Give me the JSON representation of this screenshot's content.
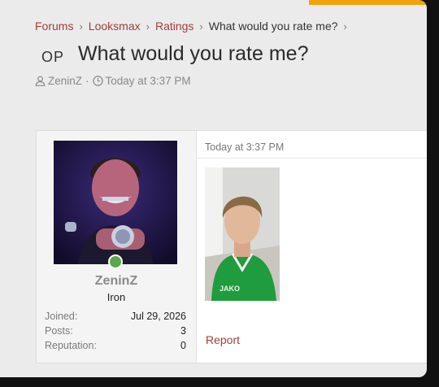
{
  "breadcrumbs": [
    {
      "label": "Forums"
    },
    {
      "label": "Looksmax"
    },
    {
      "label": "Ratings"
    },
    {
      "label": "What would you rate me?"
    }
  ],
  "thread": {
    "prefix": "OP",
    "title": "What would you rate me?",
    "author": "ZeninZ",
    "meta_sep": "·",
    "time": "Today at 3:37 PM"
  },
  "post": {
    "username": "ZeninZ",
    "rank": "Iron",
    "stats": [
      {
        "label": "Joined:",
        "value": "Jul 29, 2026"
      },
      {
        "label": "Posts:",
        "value": "3"
      },
      {
        "label": "Reputation:",
        "value": "0"
      }
    ],
    "timestamp": "Today at 3:37 PM",
    "report_label": "Report",
    "jersey_text": "JAKO"
  },
  "colors": {
    "link": "#a23d3d",
    "accent_bar": "#f0a30a",
    "online": "#5aa64a"
  },
  "icons": {
    "breadcrumb_separator": "chevron-right-icon",
    "author": "user-icon",
    "time": "clock-icon"
  }
}
